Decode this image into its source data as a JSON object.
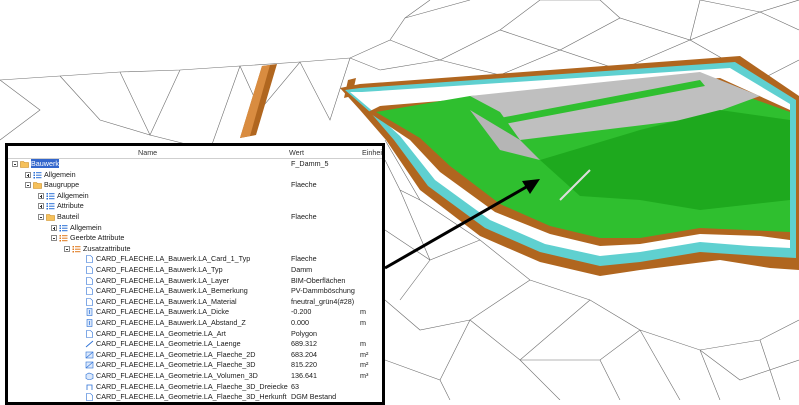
{
  "panel": {
    "columns": {
      "name": "Name",
      "value": "Wert",
      "unit": "Einheit"
    }
  },
  "colors": {
    "embankment_green": "#2fbf2f",
    "brown_layer": "#b0661f",
    "cyan_layer": "#5fd0d0",
    "concrete_gray": "#bfbfbf",
    "selection_blue": "#3366cc"
  },
  "tree": [
    {
      "label": "Bauwerk",
      "value": "F_Damm_5",
      "unit": "",
      "depth": 0,
      "icon": "folder-icon",
      "toggle": "minus",
      "selected": true
    },
    {
      "label": "Allgemein",
      "value": "",
      "unit": "",
      "depth": 1,
      "icon": "list-icon",
      "toggle": "plus"
    },
    {
      "label": "Baugruppe",
      "value": "Flaeche",
      "unit": "",
      "depth": 1,
      "icon": "folder-icon",
      "toggle": "minus"
    },
    {
      "label": "Allgemein",
      "value": "",
      "unit": "",
      "depth": 2,
      "icon": "list-icon",
      "toggle": "plus"
    },
    {
      "label": "Attribute",
      "value": "",
      "unit": "",
      "depth": 2,
      "icon": "list-icon",
      "toggle": "plus"
    },
    {
      "label": "Bauteil",
      "value": "Flaeche",
      "unit": "",
      "depth": 2,
      "icon": "folder-icon",
      "toggle": "minus"
    },
    {
      "label": "Allgemein",
      "value": "",
      "unit": "",
      "depth": 3,
      "icon": "list-icon",
      "toggle": "plus"
    },
    {
      "label": "Geerbte Attribute",
      "value": "",
      "unit": "",
      "depth": 3,
      "icon": "list-orange-icon",
      "toggle": "minus"
    },
    {
      "label": "Zusatzattribute",
      "value": "",
      "unit": "",
      "depth": 4,
      "icon": "list-orange-icon",
      "toggle": "minus"
    },
    {
      "label": "CARD_FLAECHE.LA_Bauwerk.LA_Card_1_Typ",
      "value": "Flaeche",
      "unit": "",
      "depth": 5,
      "icon": "doc-icon"
    },
    {
      "label": "CARD_FLAECHE.LA_Bauwerk.LA_Typ",
      "value": "Damm",
      "unit": "",
      "depth": 5,
      "icon": "doc-icon"
    },
    {
      "label": "CARD_FLAECHE.LA_Bauwerk.LA_Layer",
      "value": "BIM-Oberflächen",
      "unit": "",
      "depth": 5,
      "icon": "doc-icon"
    },
    {
      "label": "CARD_FLAECHE.LA_Bauwerk.LA_Bemerkung",
      "value": "PV-Dammböschung",
      "unit": "",
      "depth": 5,
      "icon": "doc-icon"
    },
    {
      "label": "CARD_FLAECHE.LA_Bauwerk.LA_Material",
      "value": "fneutral_grün4(#28)",
      "unit": "",
      "depth": 5,
      "icon": "doc-icon"
    },
    {
      "label": "CARD_FLAECHE.LA_Bauwerk.LA_Dicke",
      "value": "-0.200",
      "unit": "m",
      "depth": 5,
      "icon": "thickness-icon"
    },
    {
      "label": "CARD_FLAECHE.LA_Bauwerk.LA_Abstand_Z",
      "value": "0.000",
      "unit": "m",
      "depth": 5,
      "icon": "thickness-icon"
    },
    {
      "label": "CARD_FLAECHE.LA_Geometrie.LA_Art",
      "value": "Polygon",
      "unit": "",
      "depth": 5,
      "icon": "doc-icon"
    },
    {
      "label": "CARD_FLAECHE.LA_Geometrie.LA_Laenge",
      "value": "689.312",
      "unit": "m",
      "depth": 5,
      "icon": "length-icon"
    },
    {
      "label": "CARD_FLAECHE.LA_Geometrie.LA_Flaeche_2D",
      "value": "683.204",
      "unit": "m²",
      "depth": 5,
      "icon": "area-icon"
    },
    {
      "label": "CARD_FLAECHE.LA_Geometrie.LA_Flaeche_3D",
      "value": "815.220",
      "unit": "m²",
      "depth": 5,
      "icon": "area-icon"
    },
    {
      "label": "CARD_FLAECHE.LA_Geometrie.LA_Volumen_3D",
      "value": "136.641",
      "unit": "m³",
      "depth": 5,
      "icon": "volume-icon"
    },
    {
      "label": "CARD_FLAECHE.LA_Geometrie.LA_Flaeche_3D_Dreiecke",
      "value": "63",
      "unit": "",
      "depth": 5,
      "icon": "count-icon"
    },
    {
      "label": "CARD_FLAECHE.LA_Geometrie.LA_Flaeche_3D_Herkunft",
      "value": "DGM Bestand",
      "unit": "",
      "depth": 5,
      "icon": "doc-icon"
    }
  ]
}
